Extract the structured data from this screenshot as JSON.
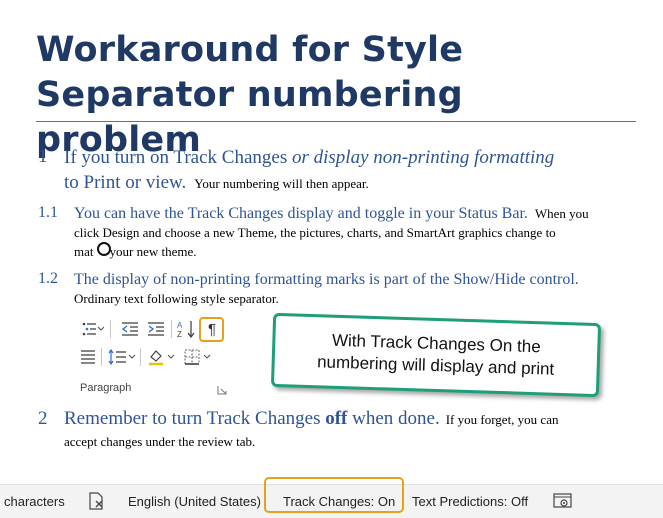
{
  "document": {
    "title_line1": "Workaround for Style",
    "title_line2": "Separator numbering problem",
    "p1": {
      "number": "1",
      "heading_a": "If you turn on Track Changes ",
      "heading_italic": "or display non-printing formatting",
      "heading_b": "to Print or view.",
      "body": "Your numbering will then appear."
    },
    "p11": {
      "number": "1.1",
      "heading": "You can have the Track Changes display and toggle in your Status Bar.",
      "body_1": "When you",
      "body_2": "click Design and choose a new Theme, the pictures, charts, and SmartArt graphics change to",
      "body_3a": "mat",
      "body_3b": "your new theme."
    },
    "p12": {
      "number": "1.2",
      "heading": "The display of non-printing formatting marks is part of the Show/Hide control.",
      "body": "Ordinary text following style separator."
    },
    "p2": {
      "number": "2",
      "heading_a": "Remember to turn Track Changes ",
      "heading_bold": "off",
      "heading_b": " when done.",
      "body_1": "If you forget, you can",
      "body_2": "accept changes under the review tab."
    }
  },
  "ribbon": {
    "group_label": "Paragraph",
    "icons": [
      "multilevel-list-icon",
      "decrease-indent-icon",
      "increase-indent-icon",
      "sort-icon",
      "pilcrow-icon",
      "justify-icon",
      "line-spacing-icon",
      "shading-icon",
      "borders-icon",
      "dialog-launcher-icon"
    ]
  },
  "callout": {
    "line1": "With Track Changes On the",
    "line2": "numbering will display and print"
  },
  "statusbar": {
    "characters": "characters",
    "language": "English (United States)",
    "track_changes": "Track Changes: On",
    "text_predictions": "Text Predictions: Off"
  },
  "colors": {
    "title": "#1f3864",
    "heading": "#2f5496",
    "highlight": "#e5a11c",
    "callout_border": "#1f9e7a"
  }
}
